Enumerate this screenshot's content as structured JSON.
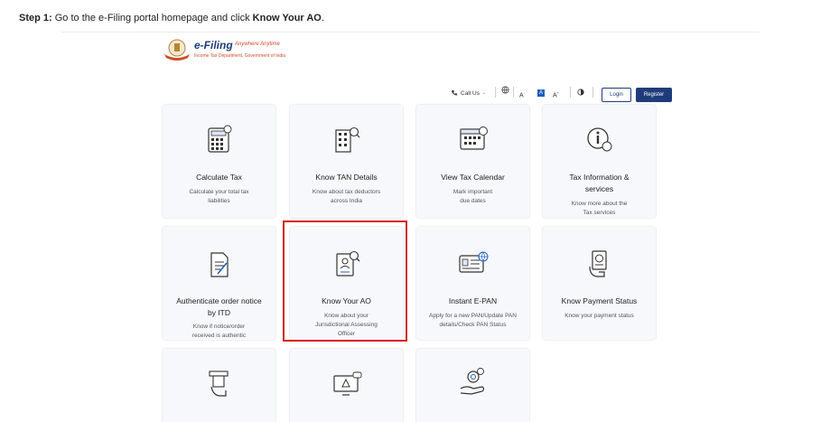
{
  "instruction": {
    "prefix": "Step 1:",
    "text": " Go to the e-Filing portal homepage and click ",
    "target": "Know Your AO",
    "suffix": "."
  },
  "portal": {
    "logo_title": "e-Filing",
    "logo_tagline": "Anywhere Anytime",
    "logo_subtitle": "Income Tax Department, Government of India"
  },
  "header": {
    "call_us": "Call Us",
    "font_small": "A",
    "font_normal": "A",
    "font_large": "A",
    "login": "Login",
    "register": "Register"
  },
  "cards": [
    {
      "title": "Calculate Tax",
      "desc": "Calculate your total tax liabilities",
      "icon": "calculator-icon"
    },
    {
      "title": "Know TAN Details",
      "desc": "Know about tax deductors across India",
      "icon": "building-search-icon"
    },
    {
      "title": "View Tax Calendar",
      "desc": "Mark important due dates",
      "icon": "calendar-icon"
    },
    {
      "title": "Tax Information & services",
      "desc": "Know more about the Tax services",
      "icon": "info-rupee-icon"
    },
    {
      "title": "Authenticate order notice by ITD",
      "desc": "Know if notice/order received is authentic",
      "icon": "document-pen-icon"
    },
    {
      "title": "Know Your AO",
      "desc": "Know about your Jurisdictional Assessing Officer",
      "icon": "officer-search-icon"
    },
    {
      "title": "Instant E-PAN",
      "desc": "Apply for a new PAN/Update PAN details/Check PAN Status",
      "icon": "pan-card-icon"
    },
    {
      "title": "Know Payment Status",
      "desc": "Know your payment status",
      "icon": "hand-receipt-icon"
    }
  ],
  "colors": {
    "brand_navy": "#1f3c7a",
    "highlight": "#d21f1f"
  }
}
